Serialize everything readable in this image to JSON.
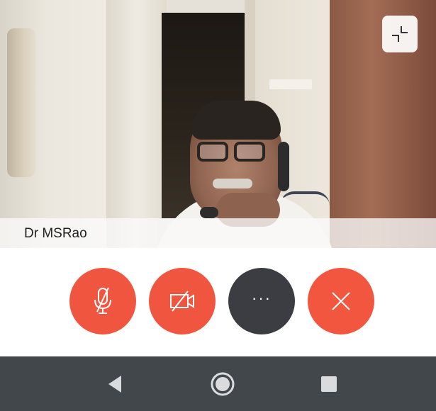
{
  "call": {
    "participant_name": "Dr MSRao"
  },
  "icons": {
    "minimize": "minimize-icon",
    "mic_off": "mic-off-icon",
    "video_off": "video-off-icon",
    "more": "more-icon",
    "end_call": "end-call-icon",
    "nav_back": "back-triangle-icon",
    "nav_home": "home-circle-icon",
    "nav_recents": "recents-square-icon"
  },
  "colors": {
    "danger": "#f0563f",
    "more_button": "#3b3d42",
    "nav_bar": "#41474b"
  },
  "controls": {
    "more_glyph": "···"
  }
}
